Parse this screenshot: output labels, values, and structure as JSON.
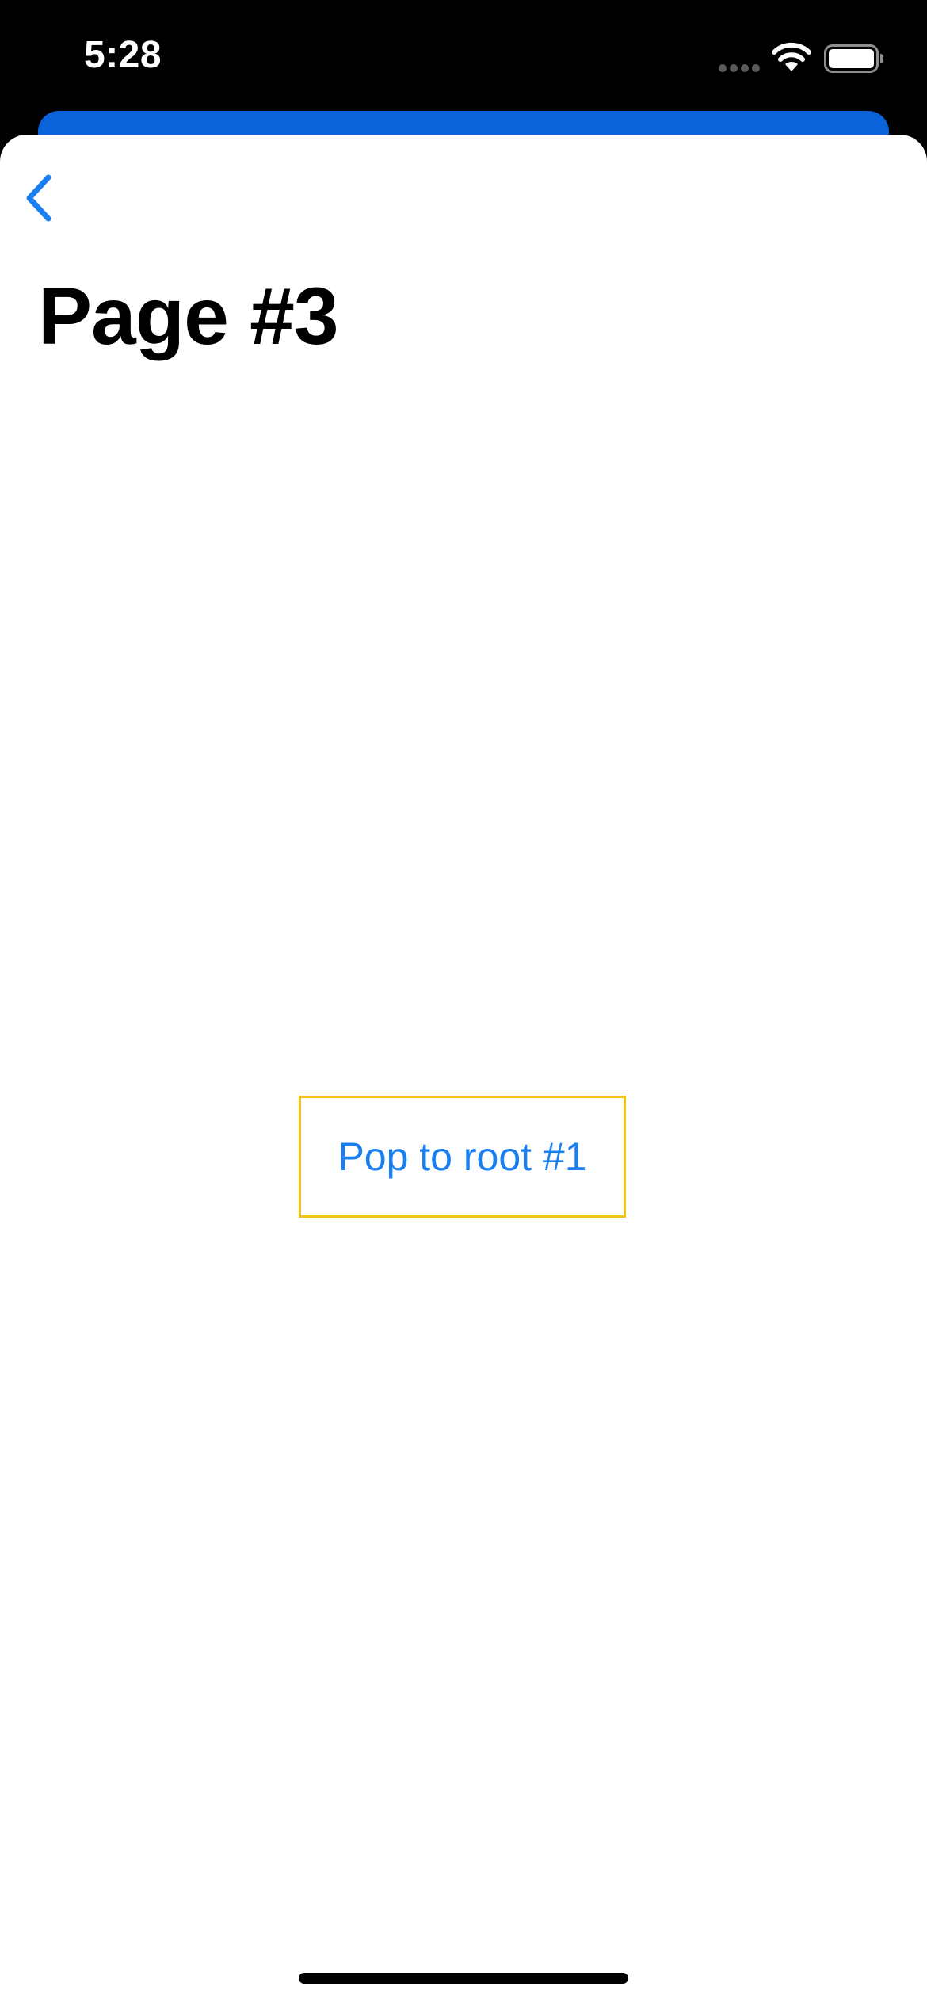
{
  "status_bar": {
    "time": "5:28",
    "icons": [
      "cellular-dots-icon",
      "wifi-icon",
      "battery-icon"
    ]
  },
  "nav": {
    "back_icon": "chevron-left-icon",
    "title": "Page #3"
  },
  "main": {
    "pop_button_label": "Pop to root #1"
  },
  "colors": {
    "accent": "#1a7ff0",
    "presenting_sheet": "#0a63d9",
    "button_border": "#f2c21b",
    "status_bar_background": "#000000",
    "sheet_background": "#ffffff"
  }
}
